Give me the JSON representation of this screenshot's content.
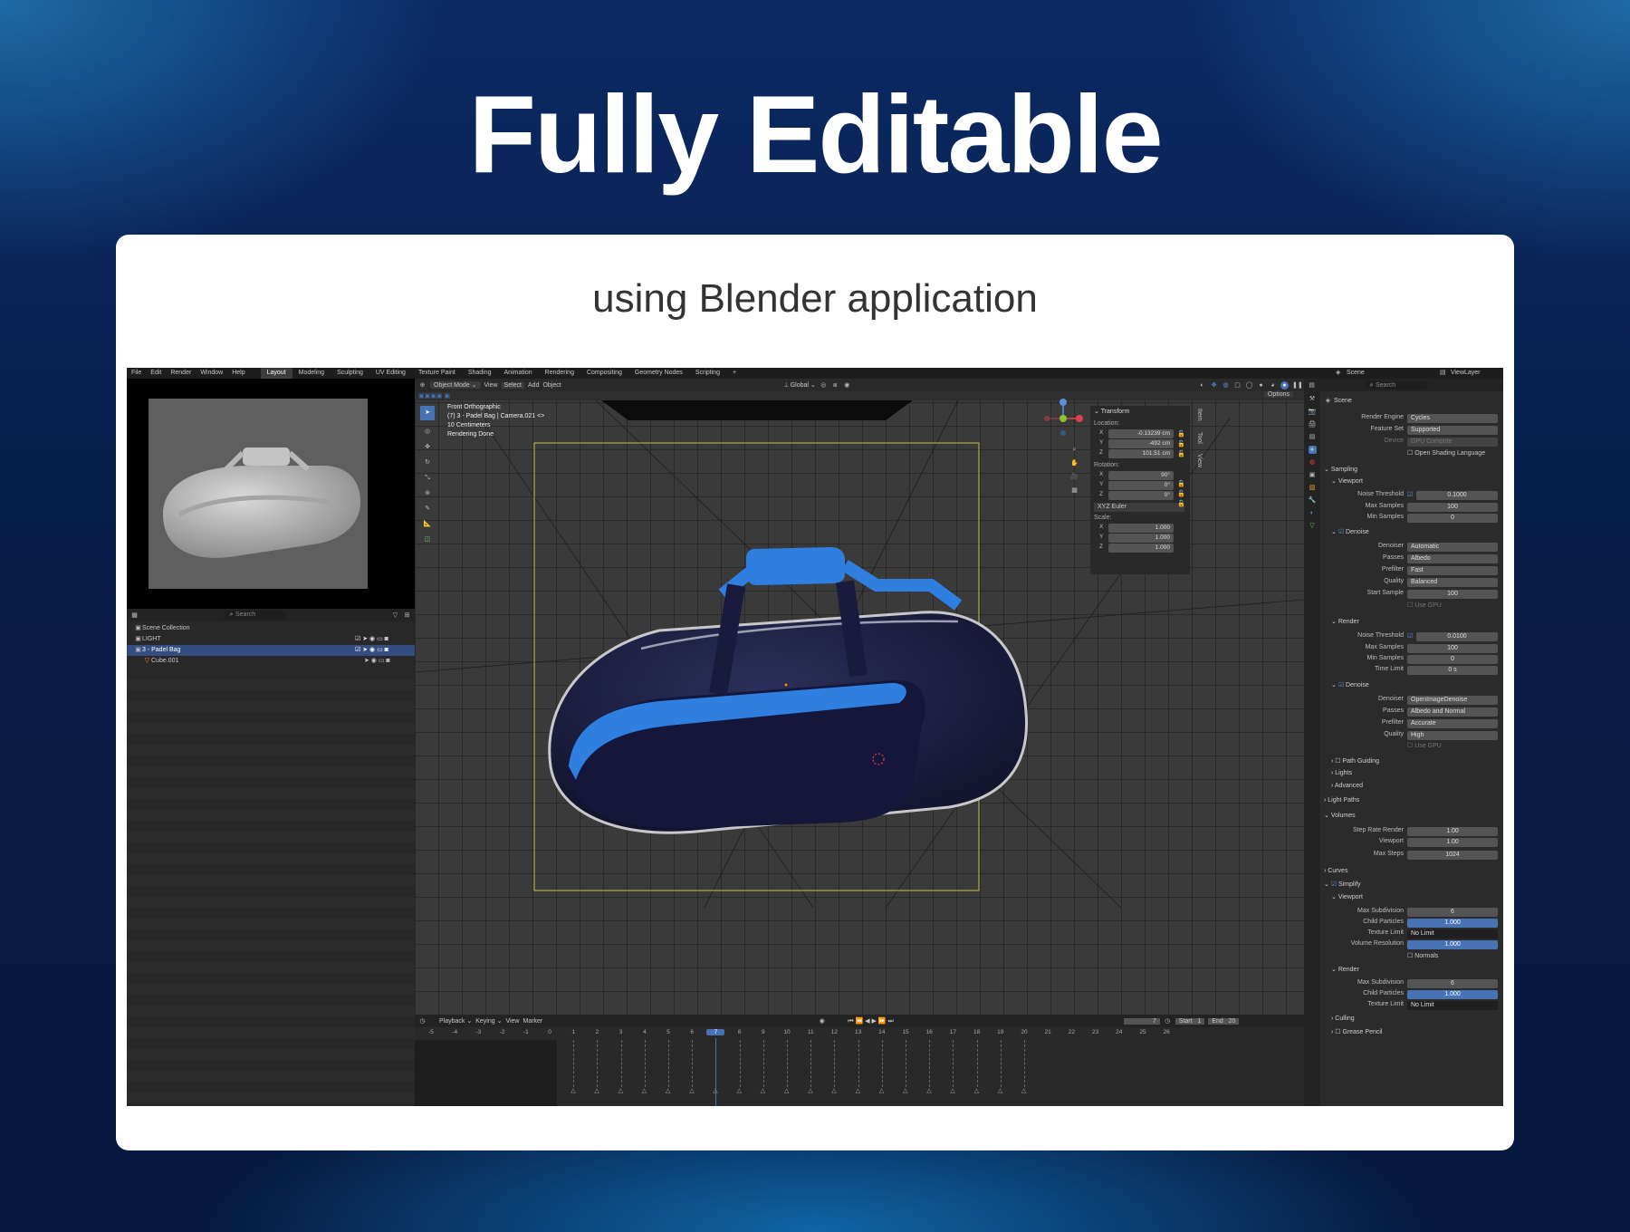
{
  "headline": "Fully Editable",
  "subtitle": "using Blender application",
  "blender": {
    "menu": [
      "File",
      "Edit",
      "Render",
      "Window",
      "Help"
    ],
    "workspaces": [
      "Layout",
      "Modeling",
      "Sculpting",
      "UV Editing",
      "Texture Paint",
      "Shading",
      "Animation",
      "Rendering",
      "Compositing",
      "Geometry Nodes",
      "Scripting",
      "+"
    ],
    "active_workspace": "Layout",
    "top_right": {
      "scene": "Scene",
      "view_layer": "ViewLayer"
    },
    "viewport": {
      "mode": "Object Mode",
      "menus": [
        "View",
        "Select",
        "Add",
        "Object"
      ],
      "transform_orientation": "Global",
      "options": "Options",
      "overlay_text": [
        "Front Orthographic",
        "(7) 3 - Padel Bag | Camera.021 <>",
        "10 Centimeters",
        "Rendering Done"
      ]
    },
    "n_panel": {
      "title": "Transform",
      "location_label": "Location:",
      "location": [
        [
          "X",
          "-0.13239 cm"
        ],
        [
          "Y",
          "-492 cm"
        ],
        [
          "Z",
          "101.51 cm"
        ]
      ],
      "rotation_label": "Rotation:",
      "rotation": [
        [
          "X",
          "90°"
        ],
        [
          "Y",
          "0°"
        ],
        [
          "Z",
          "0°"
        ]
      ],
      "rotation_mode": "XYZ Euler",
      "scale_label": "Scale:",
      "scale": [
        [
          "X",
          "1.000"
        ],
        [
          "Y",
          "1.000"
        ],
        [
          "Z",
          "1.000"
        ]
      ],
      "tabs": [
        "Item",
        "Tool",
        "View"
      ]
    },
    "outliner": {
      "search": "Search",
      "items": [
        "Scene Collection",
        "LIGHT",
        "3 - Padel Bag",
        "Cube.001"
      ]
    },
    "timeline": {
      "menus": [
        "Playback",
        "Keying",
        "View",
        "Marker"
      ],
      "current_frame": "7",
      "start_label": "Start",
      "start": "1",
      "end_label": "End",
      "end": "20",
      "ticks": [
        "-5",
        "-4",
        "-3",
        "-2",
        "-1",
        "0",
        "1",
        "2",
        "3",
        "4",
        "5",
        "6",
        "7",
        "8",
        "9",
        "10",
        "11",
        "12",
        "13",
        "14",
        "15",
        "16",
        "17",
        "18",
        "19",
        "20",
        "21",
        "22",
        "23",
        "24",
        "25",
        "26"
      ]
    },
    "properties": {
      "search": "Search",
      "scene": "Scene",
      "render_engine": [
        "Render Engine",
        "Cycles"
      ],
      "feature_set": [
        "Feature Set",
        "Supported"
      ],
      "device": [
        "Device",
        "GPU Compute"
      ],
      "osl": "Open Shading Language",
      "sampling": "Sampling",
      "viewport": "Viewport",
      "vp_rows": [
        [
          "Noise Threshold",
          "0.1000"
        ],
        [
          "Max Samples",
          "100"
        ],
        [
          "Min Samples",
          "0"
        ]
      ],
      "denoise": "Denoise",
      "vp_denoise": [
        [
          "Denoiser",
          "Automatic"
        ],
        [
          "Passes",
          "Albedo"
        ],
        [
          "Prefilter",
          "Fast"
        ],
        [
          "Quality",
          "Balanced"
        ],
        [
          "Start Sample",
          "100"
        ]
      ],
      "use_gpu": "Use GPU",
      "render": "Render",
      "r_rows": [
        [
          "Noise Threshold",
          "0.0100"
        ],
        [
          "Max Samples",
          "100"
        ],
        [
          "Min Samples",
          "0"
        ],
        [
          "Time Limit",
          "0 s"
        ]
      ],
      "r_denoise": [
        [
          "Denoiser",
          "OpenImageDenoise"
        ],
        [
          "Passes",
          "Albedo and Normal"
        ],
        [
          "Prefilter",
          "Accurate"
        ],
        [
          "Quality",
          "High"
        ]
      ],
      "collapsed": [
        "Path Guiding",
        "Lights",
        "Advanced",
        "Light Paths",
        "Volumes"
      ],
      "vol_rows": [
        [
          "Step Rate Render",
          "1.00"
        ],
        [
          "Viewport",
          "1.00"
        ],
        [
          "Max Steps",
          "1024"
        ]
      ],
      "curves": "Curves",
      "simplify": "Simplify",
      "s_vp": [
        [
          "Max Subdivision",
          "6"
        ],
        [
          "Child Particles",
          "1.000"
        ],
        [
          "Texture Limit",
          "No Limit"
        ],
        [
          "Volume Resolution",
          "1.000"
        ]
      ],
      "normals": "Normals",
      "s_render_label": "Render",
      "s_r": [
        [
          "Max Subdivision",
          "6"
        ],
        [
          "Child Particles",
          "1.000"
        ],
        [
          "Texture Limit",
          "No Limit"
        ]
      ],
      "culling": "Culling",
      "grease_pencil": "Grease Pencil"
    }
  }
}
